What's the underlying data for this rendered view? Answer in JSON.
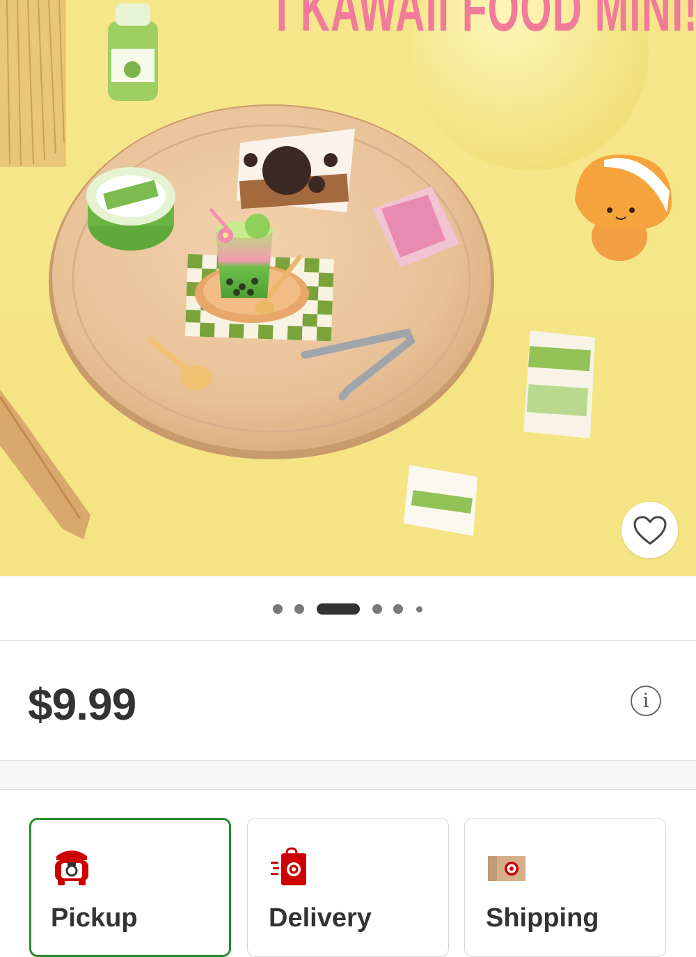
{
  "product": {
    "image_banner_text": "I KAWAII FOOD MINI!",
    "favorite_icon": "heart-outline-icon",
    "carousel": {
      "total": 6,
      "active_index": 2
    },
    "price": "$9.99",
    "price_info_icon": "info-icon"
  },
  "fulfillment": {
    "options": [
      {
        "label": "Pickup",
        "icon": "store-pickup-icon",
        "selected": true
      },
      {
        "label": "Delivery",
        "icon": "delivery-bag-icon",
        "selected": false
      },
      {
        "label": "Shipping",
        "icon": "shipping-box-icon",
        "selected": false
      }
    ]
  },
  "colors": {
    "image_background": "#f5e584",
    "banner_text": "#f27a9a",
    "selected_border": "#2a8a2a",
    "brand_red": "#cc0000",
    "price_text": "#333333"
  }
}
